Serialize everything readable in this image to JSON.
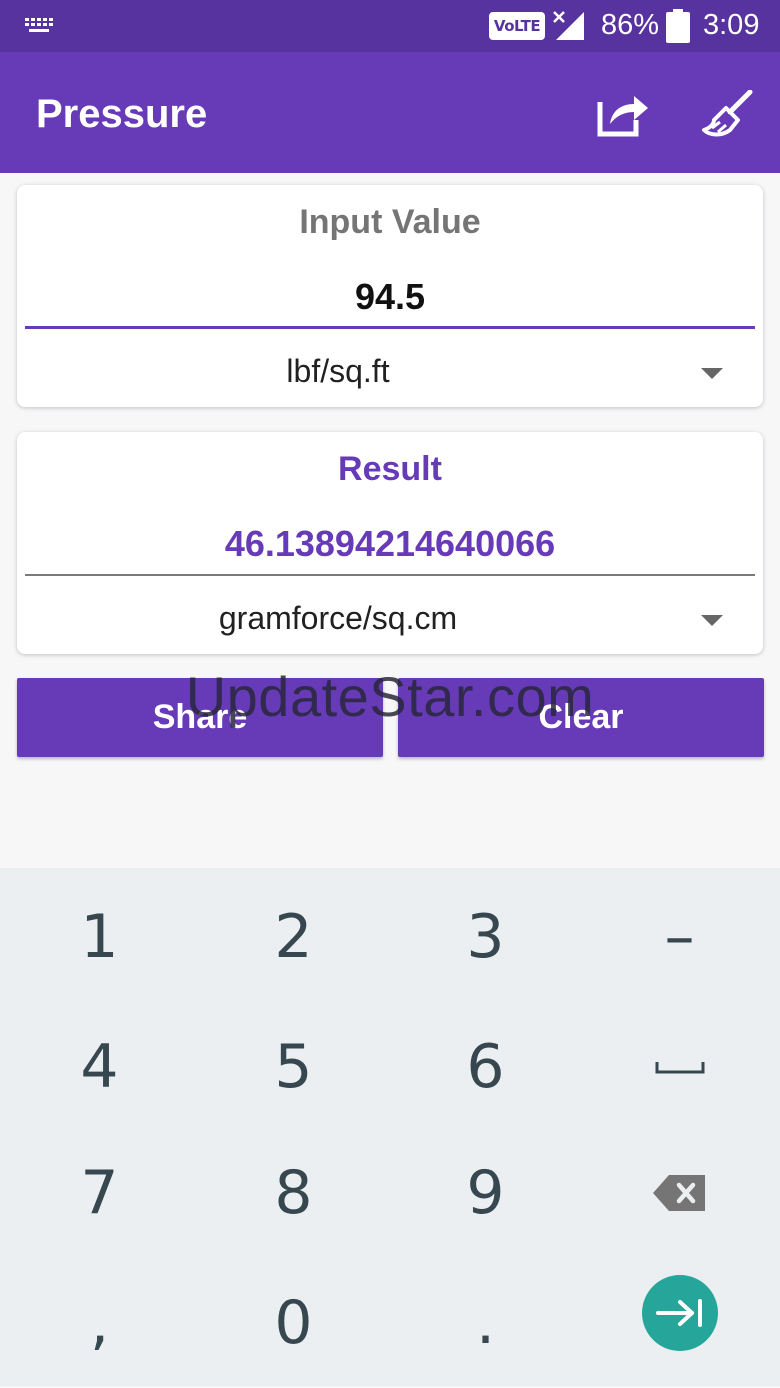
{
  "status_bar": {
    "keyboard_icon": "keyboard-icon",
    "volte": "VoLTE",
    "battery_percent": "86%",
    "time": "3:09"
  },
  "app_bar": {
    "title": "Pressure",
    "actions": [
      "share-icon",
      "broom-clear-icon"
    ]
  },
  "input_card": {
    "title": "Input Value",
    "value": "94.5",
    "unit": "lbf/sq.ft"
  },
  "result_card": {
    "title": "Result",
    "value": "46.13894214640066",
    "unit": "gramforce/sq.cm"
  },
  "buttons": {
    "share": "Share",
    "clear": "Clear"
  },
  "watermark": "UpdateStar.com",
  "keyboard": {
    "rows": [
      [
        "1",
        "2",
        "3",
        "–"
      ],
      [
        "4",
        "5",
        "6",
        "space"
      ],
      [
        "7",
        "8",
        "9",
        "backspace"
      ],
      [
        ",",
        "0",
        ".",
        "enter"
      ]
    ]
  },
  "colors": {
    "status_bar": "#5733a0",
    "primary": "#673ab7",
    "accent": "#26a69a",
    "keyboard_bg": "#eceff1"
  }
}
